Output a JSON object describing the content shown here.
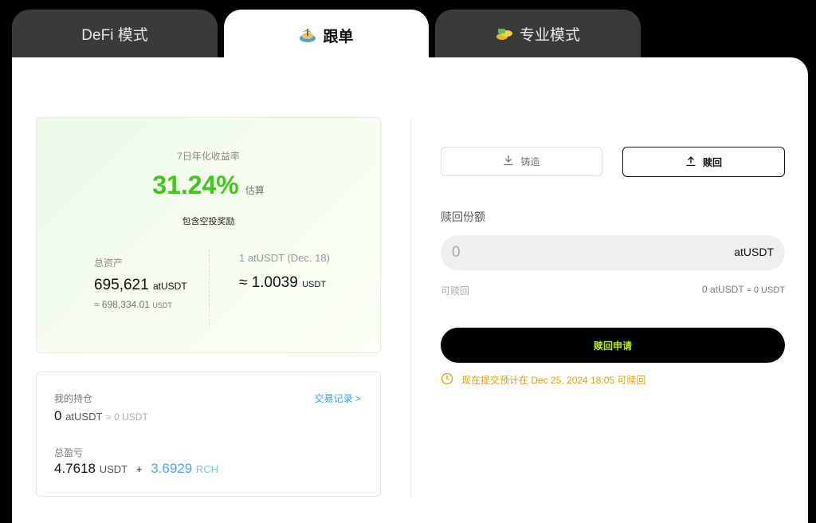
{
  "tabs": [
    {
      "label": "DeFi 模式",
      "icon": "none"
    },
    {
      "label": "跟单",
      "icon": "island-icon"
    },
    {
      "label": "专业模式",
      "icon": "coins-icon"
    }
  ],
  "apy_card": {
    "label": "7日年化收益率",
    "value": "31.24%",
    "estimate": "估算",
    "note": "包含空投奖励",
    "total_assets": {
      "label": "总资产",
      "value": "695,621",
      "unit": "atUSDT",
      "approx_value": "≈ 698,334.01",
      "approx_unit": "USDT"
    },
    "rate": {
      "label": "1 atUSDT (Dec. 18)",
      "value": "≈ 1.0039",
      "unit": "USDT"
    }
  },
  "holdings": {
    "label": "我的持仓",
    "tx_link": "交易记录 >",
    "value": "0",
    "unit": "atUSDT",
    "approx": "≈ 0 USDT",
    "pnl_label": "总盈亏",
    "pnl_usdt": "4.7618",
    "pnl_usdt_unit": "USDT",
    "plus": "+",
    "pnl_rch": "3.6929",
    "pnl_rch_unit": "RCH"
  },
  "actions": {
    "mint_label": "铸造",
    "redeem_label": "赎回"
  },
  "redeem_form": {
    "amount_label": "赎回份额",
    "placeholder": "0",
    "unit": "atUSDT",
    "redeemable_label": "可赎回",
    "redeemable_value": "0 atUSDT",
    "redeemable_approx": "≈ 0 USDT",
    "submit_label": "赎回申请",
    "notice": "现在提交预计在 Dec 25, 2024 18:05 可赎回"
  },
  "colors": {
    "accent_green": "#43c51c",
    "link_blue": "#3aa0e6",
    "submit_text": "#b5f000",
    "notice_orange": "#e0a000"
  }
}
